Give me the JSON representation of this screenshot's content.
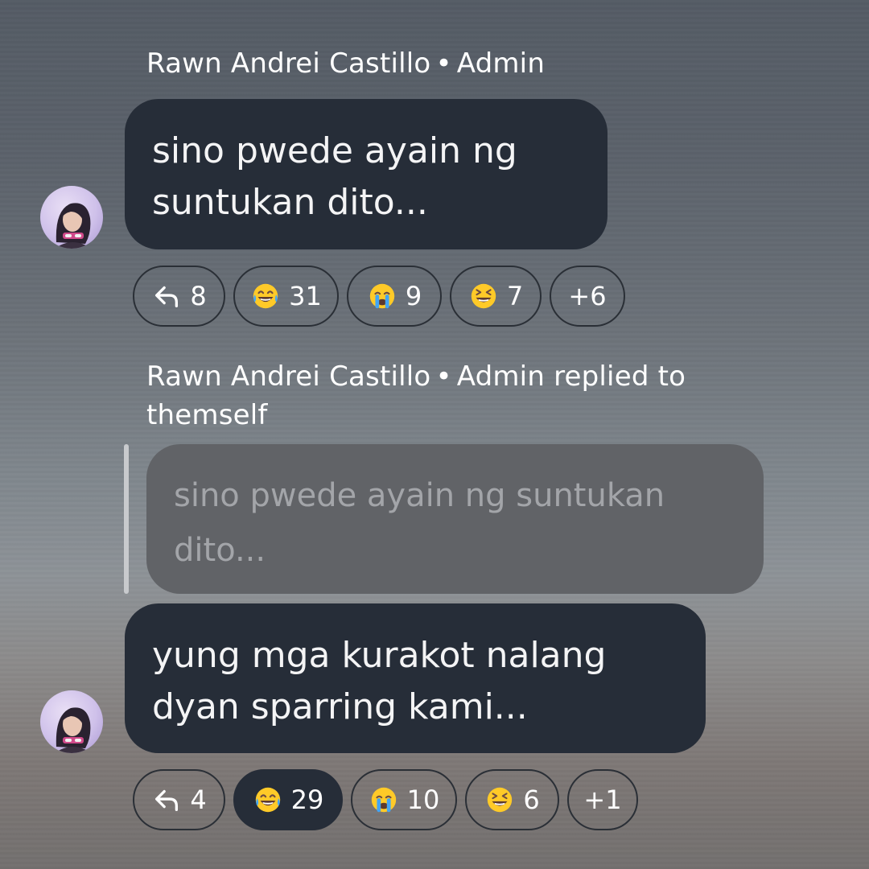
{
  "messages": [
    {
      "sender_name": "Rawn Andrei Castillo",
      "separator": "•",
      "sender_role": "Admin",
      "lines": [
        "sino pwede ayain ng",
        "suntukan dito..."
      ],
      "reactions": {
        "reply": {
          "icon": "reply-icon",
          "count": "8"
        },
        "items": [
          {
            "icon": "laughing-tears-emoji",
            "count": "31"
          },
          {
            "icon": "crying-emoji",
            "count": "9"
          },
          {
            "icon": "squinting-laugh-emoji",
            "count": "7"
          }
        ],
        "more": "+6"
      }
    },
    {
      "sender_name": "Rawn Andrei Castillo",
      "separator": "•",
      "sender_role": "Admin",
      "reply_note": "replied to",
      "reply_target": "themself",
      "quoted_lines": [
        "sino pwede ayain ng suntukan",
        "dito..."
      ],
      "lines": [
        "yung mga kurakot nalang",
        "dyan sparring kami..."
      ],
      "reactions": {
        "reply": {
          "icon": "reply-icon",
          "count": "4"
        },
        "items": [
          {
            "icon": "laughing-tears-emoji",
            "count": "29",
            "selected": true
          },
          {
            "icon": "crying-emoji",
            "count": "10"
          },
          {
            "icon": "squinting-laugh-emoji",
            "count": "6"
          }
        ],
        "more": "+1"
      }
    }
  ],
  "colors": {
    "bubble": "#262d38",
    "quote_bubble": "#616367",
    "quote_text": "#a3a5a9",
    "chip_border": "#2a2f36",
    "emoji_yellow": "#ffca28",
    "tear_blue": "#42a5f5"
  }
}
